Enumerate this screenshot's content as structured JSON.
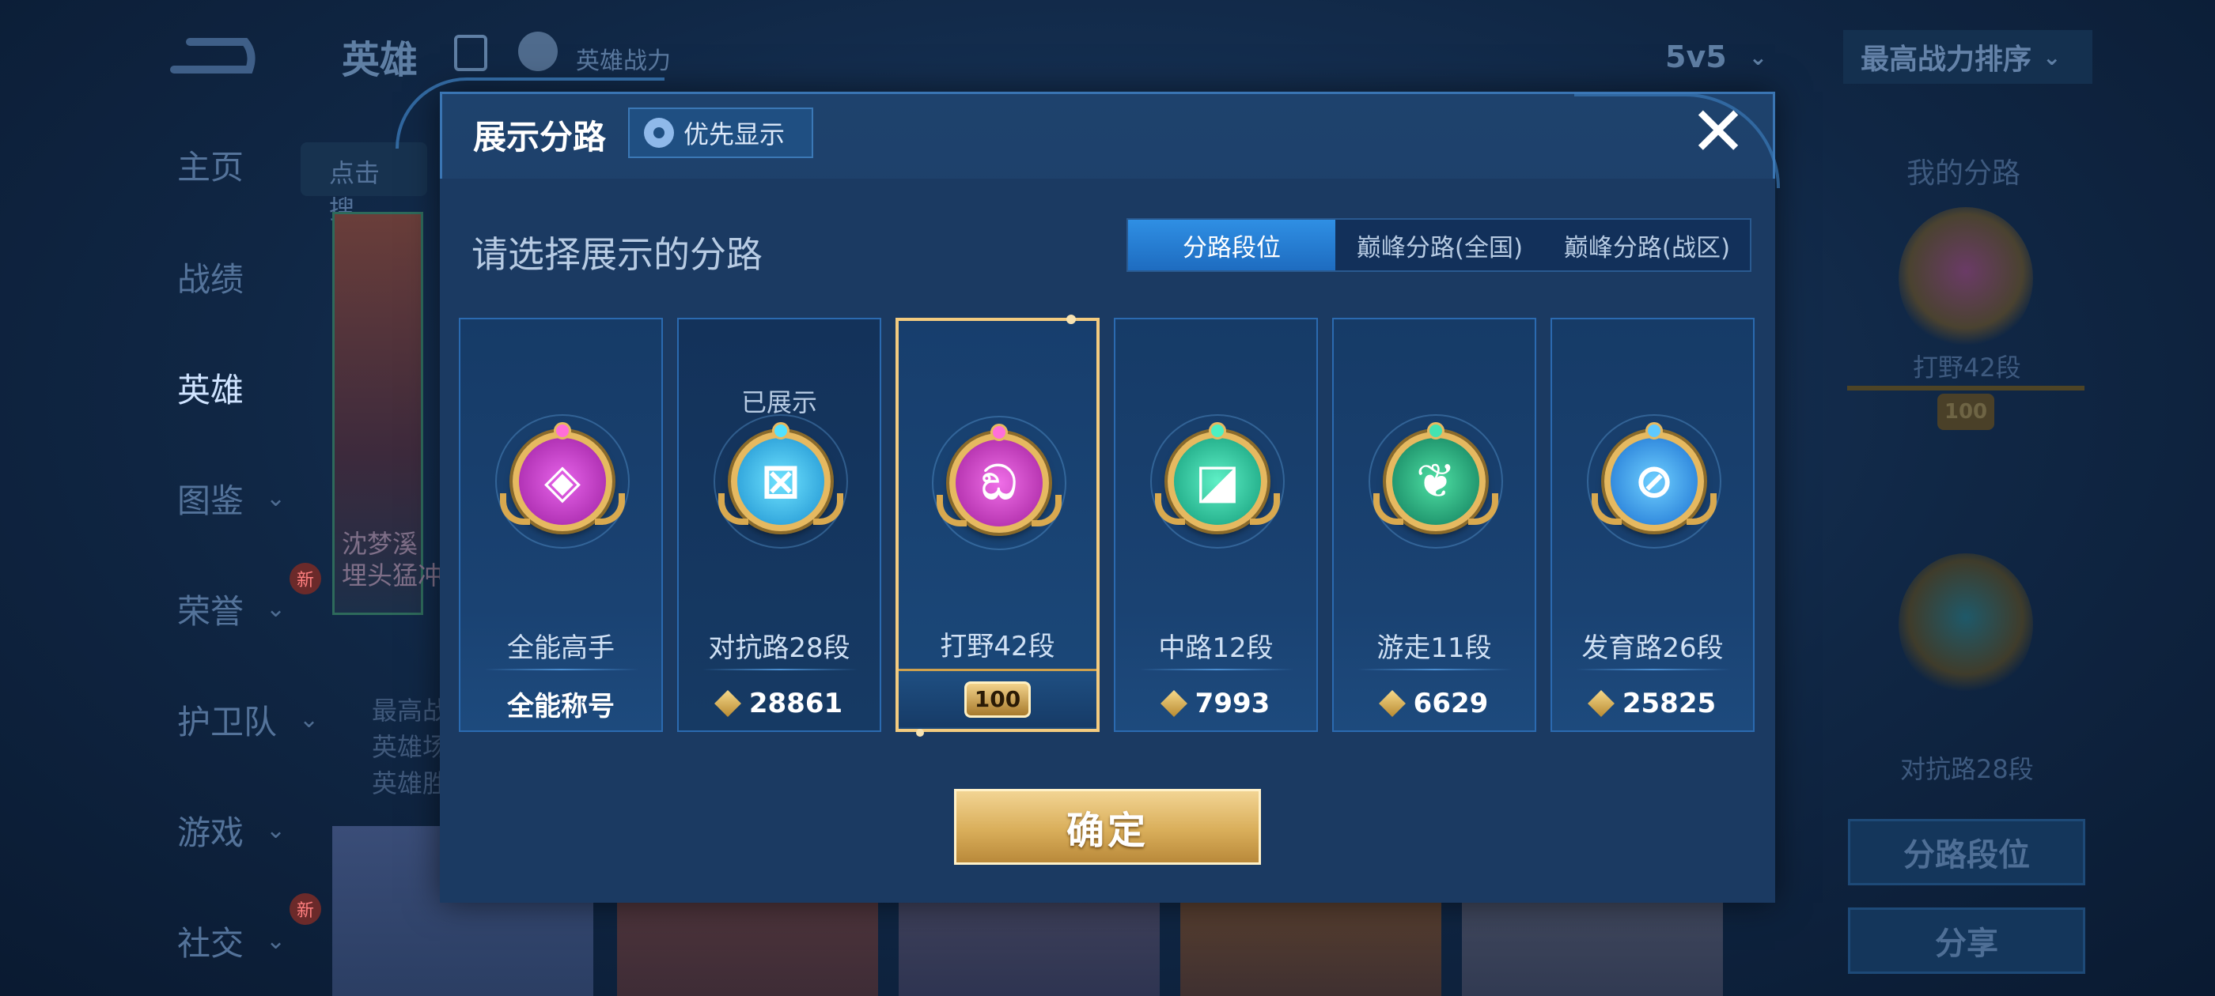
{
  "header": {
    "title": "英雄",
    "power_label": "英雄战力",
    "mode": "5v5",
    "sort": "最高战力排序"
  },
  "nav": {
    "items": [
      {
        "label": "主页"
      },
      {
        "label": "战绩"
      },
      {
        "label": "英雄"
      },
      {
        "label": "图鉴"
      },
      {
        "label": "荣誉"
      },
      {
        "label": "护卫队"
      },
      {
        "label": "游戏"
      },
      {
        "label": "社交"
      }
    ],
    "new_badge": "新"
  },
  "hero_list": {
    "search_placeholder": "点击搜",
    "card_text_1": "沈梦溪",
    "card_text_2": "埋头猛冲",
    "info_1": "最高战",
    "info_2": "英雄场",
    "info_3": "英雄胜"
  },
  "right_panel": {
    "title": "我的分路",
    "badge1_label": "打野42段",
    "badge1_rank": "100",
    "badge2_label": "对抗路28段",
    "btn_lane_rank": "分路段位",
    "btn_share": "分享"
  },
  "modal": {
    "title": "展示分路",
    "priority_button": "优先显示",
    "close_symbol": "✕",
    "subtitle": "请选择展示的分路",
    "tabs": [
      {
        "label": "分路段位",
        "active": true
      },
      {
        "label": "巅峰分路(全国)",
        "active": false
      },
      {
        "label": "巅峰分路(战区)",
        "active": false
      }
    ],
    "cards": [
      {
        "name": "全能高手",
        "footer": "全能称号",
        "top": "",
        "glyph": "◈",
        "color": "#c93bd0"
      },
      {
        "name": "对抗路28段",
        "footer": "28861",
        "top": "已展示",
        "glyph": "⊠",
        "color": "#27c4f0"
      },
      {
        "name": "打野42段",
        "footer": "100",
        "top": "",
        "glyph": "ඞ",
        "color": "#d43ccb"
      },
      {
        "name": "中路12段",
        "footer": "7993",
        "top": "",
        "glyph": "◪",
        "color": "#1fc9a3"
      },
      {
        "name": "游走11段",
        "footer": "6629",
        "top": "",
        "glyph": "❦",
        "color": "#1aa87a"
      },
      {
        "name": "发育路26段",
        "footer": "25825",
        "top": "",
        "glyph": "⊘",
        "color": "#2f8ff0"
      }
    ],
    "confirm": "确定"
  }
}
